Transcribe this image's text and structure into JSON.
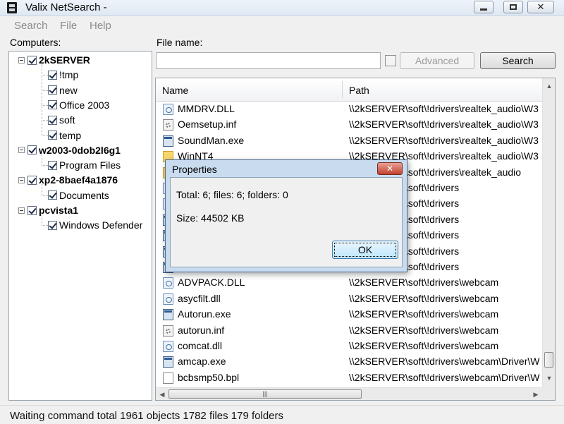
{
  "window": {
    "title": "Valix NetSearch -",
    "controls": {
      "minimize": "minimize",
      "maximize": "maximize",
      "close": "✕"
    }
  },
  "menu": [
    "Search",
    "File",
    "Help"
  ],
  "left_pane": {
    "label": "Computers:",
    "tree": [
      {
        "label": "2kSERVER",
        "level": 0,
        "bold": true,
        "expanded": true,
        "checked": true
      },
      {
        "label": "!tmp",
        "level": 1,
        "checked": true
      },
      {
        "label": "new",
        "level": 1,
        "checked": true
      },
      {
        "label": "Office 2003",
        "level": 1,
        "checked": true
      },
      {
        "label": "soft",
        "level": 1,
        "checked": true
      },
      {
        "label": "temp",
        "level": 1,
        "checked": true
      },
      {
        "label": "w2003-0dob2l6g1",
        "level": 0,
        "bold": true,
        "expanded": true,
        "checked": true
      },
      {
        "label": "Program Files",
        "level": 1,
        "checked": true
      },
      {
        "label": "xp2-8baef4a1876",
        "level": 0,
        "bold": true,
        "expanded": true,
        "checked": true
      },
      {
        "label": "Documents",
        "level": 1,
        "checked": true
      },
      {
        "label": "pcvista1",
        "level": 0,
        "bold": true,
        "expanded": true,
        "checked": true
      },
      {
        "label": "Windows Defender",
        "level": 1,
        "checked": true
      }
    ]
  },
  "right_pane": {
    "filename_label": "File name:",
    "filename_value": "",
    "advanced_checked": false,
    "advanced_label": "Advanced",
    "search_label": "Search",
    "columns": {
      "name": "Name",
      "path": "Path"
    },
    "rows": [
      {
        "icon": "dll",
        "name": "MMDRV.DLL",
        "path": "\\\\2kSERVER\\soft\\!drivers\\realtek_audio\\W3"
      },
      {
        "icon": "inf",
        "name": "Oemsetup.inf",
        "path": "\\\\2kSERVER\\soft\\!drivers\\realtek_audio\\W3"
      },
      {
        "icon": "exe",
        "name": "SoundMan.exe",
        "path": "\\\\2kSERVER\\soft\\!drivers\\realtek_audio\\W3"
      },
      {
        "icon": "folder",
        "name": "WinNT4",
        "path": "\\\\2kSERVER\\soft\\!drivers\\realtek_audio\\W3"
      },
      {
        "icon": "folder",
        "name": "",
        "path": "\\\\2kSERVER\\soft\\!drivers\\realtek_audio"
      },
      {
        "icon": "dll",
        "name": "",
        "path": "\\\\2kSERVER\\soft\\!drivers"
      },
      {
        "icon": "dll",
        "name": "",
        "path": "\\\\2kSERVER\\soft\\!drivers"
      },
      {
        "icon": "exe",
        "name": "",
        "path": "\\\\2kSERVER\\soft\\!drivers"
      },
      {
        "icon": "exe",
        "name": "",
        "path": "\\\\2kSERVER\\soft\\!drivers"
      },
      {
        "icon": "exe",
        "name": "",
        "path": "\\\\2kSERVER\\soft\\!drivers"
      },
      {
        "icon": "exe",
        "name": "",
        "path": "\\\\2kSERVER\\soft\\!drivers"
      },
      {
        "icon": "dll",
        "name": "ADVPACK.DLL",
        "path": "\\\\2kSERVER\\soft\\!drivers\\webcam"
      },
      {
        "icon": "dll",
        "name": "asycfilt.dll",
        "path": "\\\\2kSERVER\\soft\\!drivers\\webcam"
      },
      {
        "icon": "exe",
        "name": "Autorun.exe",
        "path": "\\\\2kSERVER\\soft\\!drivers\\webcam"
      },
      {
        "icon": "inf",
        "name": "autorun.inf",
        "path": "\\\\2kSERVER\\soft\\!drivers\\webcam"
      },
      {
        "icon": "dll",
        "name": "comcat.dll",
        "path": "\\\\2kSERVER\\soft\\!drivers\\webcam"
      },
      {
        "icon": "exe",
        "name": "amcap.exe",
        "path": "\\\\2kSERVER\\soft\\!drivers\\webcam\\Driver\\W"
      },
      {
        "icon": "file",
        "name": "bcbsmp50.bpl",
        "path": "\\\\2kSERVER\\soft\\!drivers\\webcam\\Driver\\W"
      }
    ]
  },
  "status": {
    "text": "Waiting command  total 1961 objects 1782 files 179 folders"
  },
  "dialog": {
    "title": "Properties",
    "close": "✕",
    "line1": "Total: 6; files: 6; folders: 0",
    "line2": "Size: 44502 KB",
    "ok_label": "OK"
  }
}
